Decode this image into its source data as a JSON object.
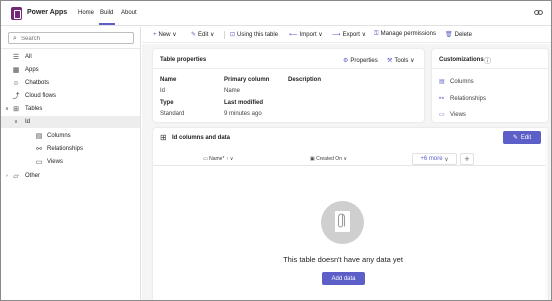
{
  "app": {
    "title": "Power Apps",
    "brand_color": "#742774",
    "accent_color": "#5b5fc7"
  },
  "header": {
    "nav": [
      {
        "label": "Home",
        "active": false
      },
      {
        "label": "Build",
        "active": true
      },
      {
        "label": "About",
        "active": false
      }
    ],
    "right_icon": "link-icon"
  },
  "sidebar": {
    "search_placeholder": "Search",
    "items": [
      {
        "label": "All",
        "icon": "list-icon"
      },
      {
        "label": "Apps",
        "icon": "apps-icon"
      },
      {
        "label": "Chatbots",
        "icon": "chatbot-icon"
      },
      {
        "label": "Cloud flows",
        "icon": "flow-icon"
      },
      {
        "label": "Tables",
        "icon": "table-icon",
        "expanded": true
      },
      {
        "label": "Id",
        "icon": "chevron-down-icon",
        "selected": true
      },
      {
        "label": "Columns",
        "icon": "columns-icon"
      },
      {
        "label": "Relationships",
        "icon": "relationships-icon"
      },
      {
        "label": "Views",
        "icon": "views-icon"
      },
      {
        "label": "Other",
        "icon": "folder-icon"
      }
    ]
  },
  "commandbar": {
    "new": "New",
    "edit": "Edit",
    "using_this_table": "Using this table",
    "import": "Import",
    "export": "Export",
    "manage_permissions": "Manage permissions",
    "delete": "Delete"
  },
  "table_properties": {
    "title": "Table properties",
    "properties_action": "Properties",
    "tools_action": "Tools",
    "name_label": "Name",
    "name_value": "Id",
    "primary_column_label": "Primary column",
    "primary_column_value": "Name",
    "description_label": "Description",
    "type_label": "Type",
    "type_value": "Standard",
    "last_modified_label": "Last modified",
    "last_modified_value": "9 minutes ago"
  },
  "customizations": {
    "title": "Customizations",
    "items": [
      {
        "label": "Columns",
        "icon": "columns-icon"
      },
      {
        "label": "Relationships",
        "icon": "relationships-icon"
      },
      {
        "label": "Views",
        "icon": "views-icon"
      }
    ]
  },
  "data_panel": {
    "title": "Id columns and data",
    "edit_button": "Edit",
    "columns": [
      {
        "label": "Name",
        "required_marker": "*",
        "sort": "↑"
      },
      {
        "label": "Created On"
      }
    ],
    "more_columns": "+6 more",
    "empty_text": "This table doesn't have any data yet",
    "add_data_button": "Add data"
  }
}
